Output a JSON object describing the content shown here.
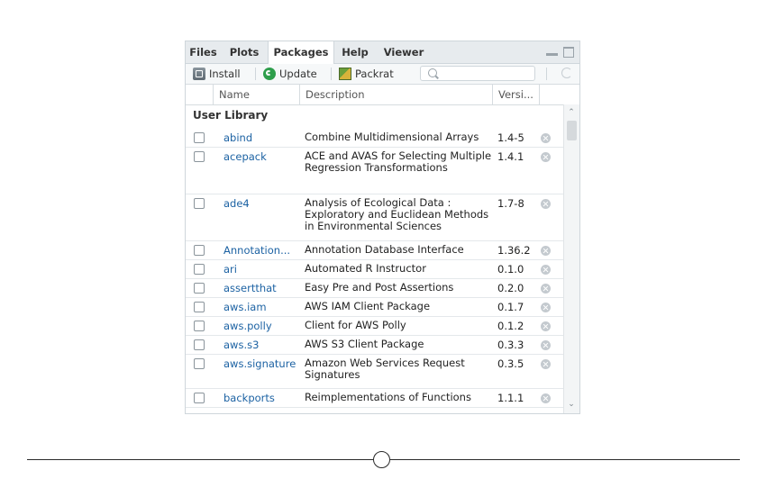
{
  "tabs": [
    "Files",
    "Plots",
    "Packages",
    "Help",
    "Viewer"
  ],
  "toolbar": {
    "install": "Install",
    "update": "Update",
    "packrat": "Packrat",
    "search_value": ""
  },
  "columns": {
    "name": "Name",
    "description": "Description",
    "version": "Versi..."
  },
  "section": "User Library",
  "packages": [
    {
      "name": "abind",
      "description": "Combine Multidimensional Arrays",
      "version": "1.4-5"
    },
    {
      "name": "acepack",
      "description": "ACE and AVAS for Selecting Multiple Regression Transformations",
      "version": "1.4.1"
    },
    {
      "name": "ade4",
      "description": "Analysis of Ecological Data : Exploratory and Euclidean Methods in Environmental Sciences",
      "version": "1.7-8"
    },
    {
      "name": "Annotation...",
      "description": "Annotation Database Interface",
      "version": "1.36.2"
    },
    {
      "name": "ari",
      "description": "Automated R Instructor",
      "version": "0.1.0"
    },
    {
      "name": "assertthat",
      "description": "Easy Pre and Post Assertions",
      "version": "0.2.0"
    },
    {
      "name": "aws.iam",
      "description": "AWS IAM Client Package",
      "version": "0.1.7"
    },
    {
      "name": "aws.polly",
      "description": "Client for AWS Polly",
      "version": "0.1.2"
    },
    {
      "name": "aws.s3",
      "description": "AWS S3 Client Package",
      "version": "0.3.3"
    },
    {
      "name": "aws.signature",
      "description": "Amazon Web Services Request Signatures",
      "version": "0.3.5"
    },
    {
      "name": "backports",
      "description": "Reimplementations of Functions",
      "version": "1.1.1"
    }
  ],
  "icons": [
    "install-icon",
    "update-icon",
    "packrat-icon",
    "search-icon",
    "refresh-icon",
    "minimize-icon",
    "maximize-icon",
    "delete-icon"
  ],
  "colors": {
    "package_link": "#1c62a3",
    "update_green": "#2e9e4b"
  }
}
